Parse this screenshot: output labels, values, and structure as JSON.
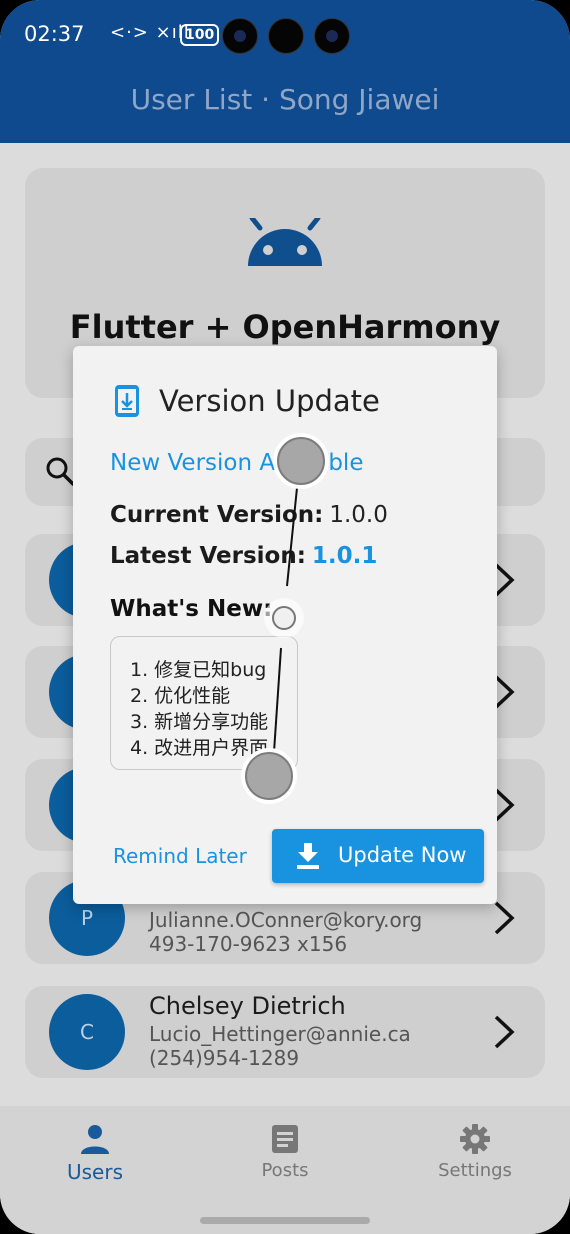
{
  "status_bar": {
    "time": "02:37",
    "signal": "<·> ×ıll",
    "battery": "100"
  },
  "appbar": {
    "title": "User List · Song Jiawei"
  },
  "top_card": {
    "title": "Flutter + OpenHarmony",
    "icon": "android-icon"
  },
  "users": [
    {
      "initial": "P",
      "name": "",
      "email": "Julianne.OConner@kory.org",
      "phone": "493-170-9623 x156"
    },
    {
      "initial": "C",
      "name": "Chelsey Dietrich",
      "email": "Lucio_Hettinger@annie.ca",
      "phone": "(254)954-1289"
    }
  ],
  "dialog": {
    "title": "Version Update",
    "subtitle": "New Version Available",
    "current_label": "Current Version:",
    "current_value": "1.0.0",
    "latest_label": "Latest Version:",
    "latest_value": "1.0.1",
    "whats_new_label": "What's New:",
    "notes": [
      "1. 修复已知bug",
      "2. 优化性能",
      "3. 新增分享功能",
      "4. 改进用户界面"
    ],
    "later_label": "Remind Later",
    "update_label": "Update Now",
    "accent_color": "#1993e0"
  },
  "bottom_nav": {
    "items": [
      {
        "label": "Users",
        "icon": "person-icon",
        "active": true
      },
      {
        "label": "Posts",
        "icon": "article-icon",
        "active": false
      },
      {
        "label": "Settings",
        "icon": "gear-icon",
        "active": false
      }
    ]
  }
}
